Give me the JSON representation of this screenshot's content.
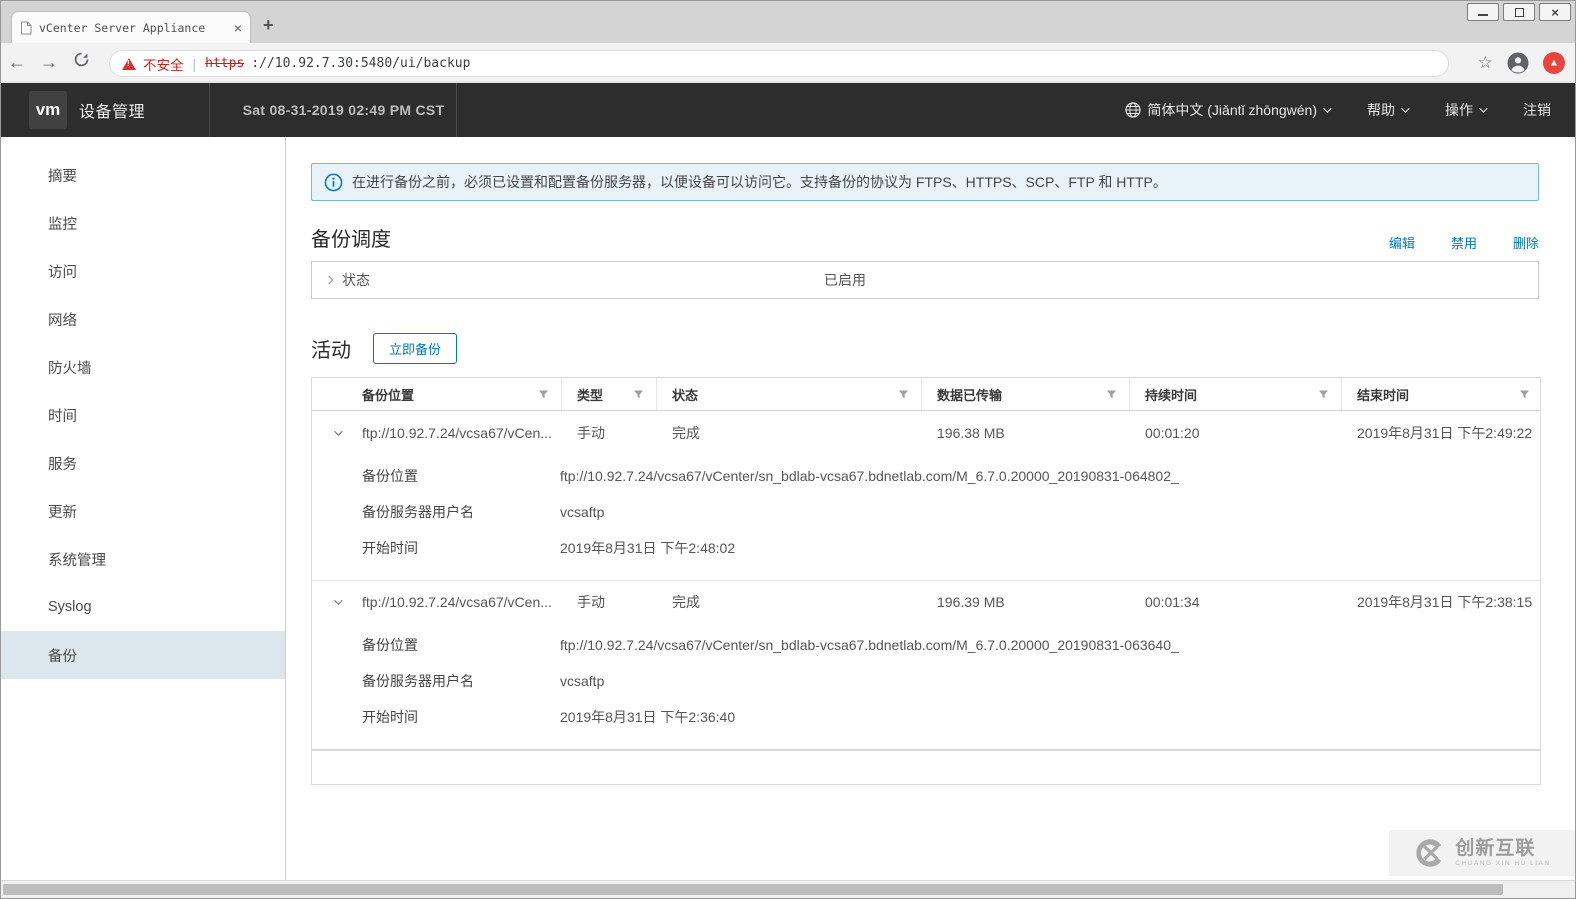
{
  "browser": {
    "tab": {
      "title": "vCenter Server Appliance"
    },
    "address": {
      "security_label": "不安全",
      "scheme": "https",
      "rest": "://10.92.7.30:5480/ui/backup"
    }
  },
  "appbar": {
    "logo": "vm",
    "title": "设备管理",
    "datetime": "Sat 08-31-2019 02:49 PM CST",
    "language": "简体中文 (Jiǎntǐ zhōngwén)",
    "help": "帮助",
    "actions": "操作",
    "logout": "注销"
  },
  "sidebar": {
    "items": [
      {
        "label": "摘要",
        "selected": false
      },
      {
        "label": "监控",
        "selected": false
      },
      {
        "label": "访问",
        "selected": false
      },
      {
        "label": "网络",
        "selected": false
      },
      {
        "label": "防火墙",
        "selected": false
      },
      {
        "label": "时间",
        "selected": false
      },
      {
        "label": "服务",
        "selected": false
      },
      {
        "label": "更新",
        "selected": false
      },
      {
        "label": "系统管理",
        "selected": false
      },
      {
        "label": "Syslog",
        "selected": false
      },
      {
        "label": "备份",
        "selected": true
      }
    ]
  },
  "banner": {
    "text": "在进行备份之前，必须已设置和配置备份服务器，以便设备可以访问它。支持备份的协议为 FTPS、HTTPS、SCP、FTP 和 HTTP。"
  },
  "schedule": {
    "title": "备份调度",
    "edit_label": "编辑",
    "disable_label": "禁用",
    "delete_label": "删除",
    "status_label": "状态",
    "status_value": "已启用"
  },
  "activity": {
    "title": "活动",
    "backup_now_label": "立即备份",
    "columns": [
      "备份位置",
      "类型",
      "状态",
      "数据已传输",
      "持续时间",
      "结束时间"
    ],
    "detail_labels": {
      "location": "备份位置",
      "username": "备份服务器用户名",
      "start_time": "开始时间"
    },
    "rows": [
      {
        "location": "ftp://10.92.7.24/vcsa67/vCen...",
        "type": "手动",
        "status": "完成",
        "transferred": "196.38 MB",
        "duration": "00:01:20",
        "end_time": "2019年8月31日 下午2:49:22",
        "location_full": "ftp://10.92.7.24/vcsa67/vCenter/sn_bdlab-vcsa67.bdnetlab.com/M_6.7.0.20000_20190831-064802_",
        "username": "vcsaftp",
        "start_time": "2019年8月31日 下午2:48:02"
      },
      {
        "location": "ftp://10.92.7.24/vcsa67/vCen...",
        "type": "手动",
        "status": "完成",
        "transferred": "196.39 MB",
        "duration": "00:01:34",
        "end_time": "2019年8月31日 下午2:38:15",
        "location_full": "ftp://10.92.7.24/vcsa67/vCenter/sn_bdlab-vcsa67.bdnetlab.com/M_6.7.0.20000_20190831-063640_",
        "username": "vcsaftp",
        "start_time": "2019年8月31日 下午2:36:40"
      }
    ]
  },
  "watermark": {
    "name": "创新互联",
    "subtitle": "CHUANG XIN HU LIAN"
  },
  "colors": {
    "accent_blue": "#0079b8",
    "alert_border": "#77b7dc",
    "alert_bg": "#e7f3f9",
    "danger_red": "#c5221f",
    "appbar_bg": "#2d2d2d"
  }
}
